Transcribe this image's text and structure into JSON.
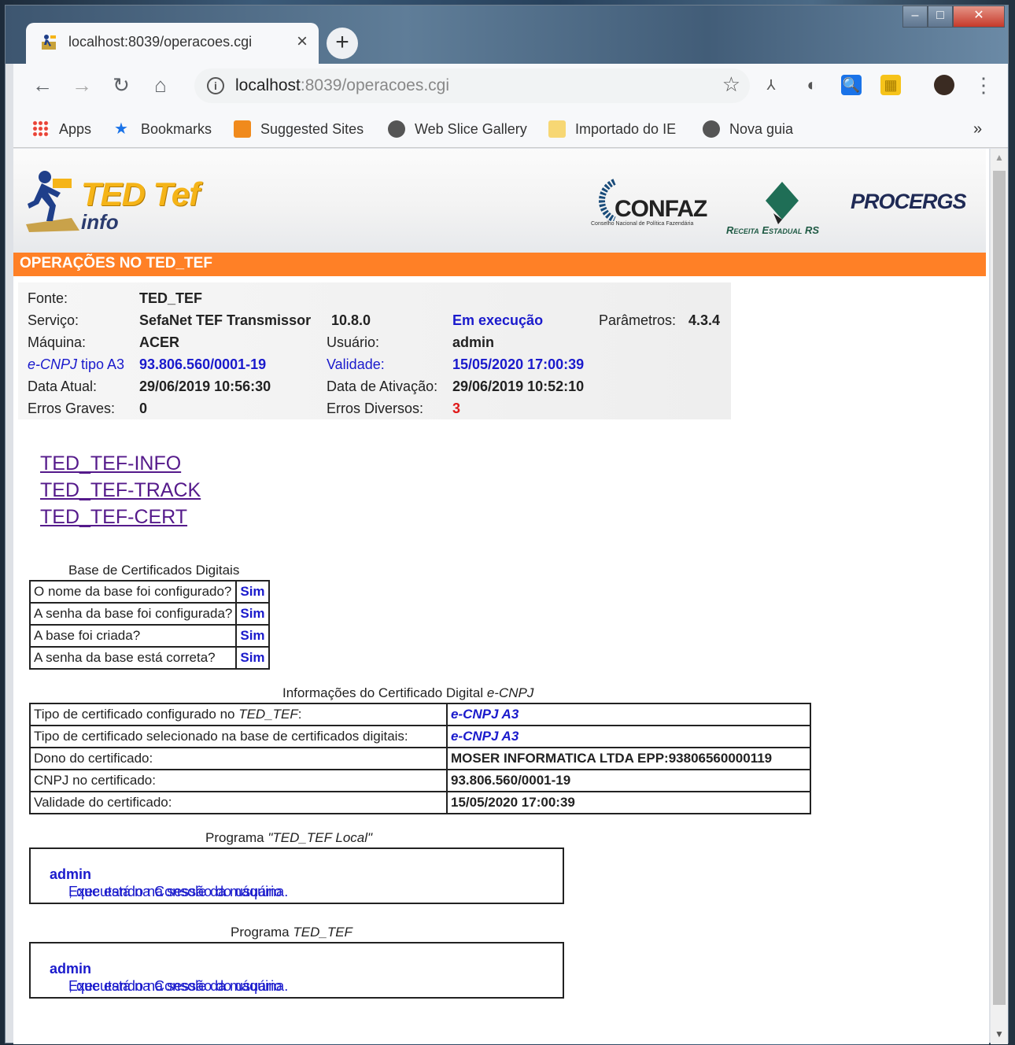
{
  "browser": {
    "tab_title": "localhost:8039/operacoes.cgi",
    "tab_close": "×",
    "new_tab": "+",
    "url_host": "localhost",
    "url_rest": ":8039/operacoes.cgi",
    "bookmarks": [
      "Apps",
      "Bookmarks",
      "Suggested Sites",
      "Web Slice Gallery",
      "Importado do IE",
      "Nova guia"
    ],
    "more": "»"
  },
  "header": {
    "logo_title": "TED Tef",
    "logo_sub": "info",
    "confaz": "CONFAZ",
    "confaz_sub": "Conselho Nacional de Política Fazendária",
    "receita": "Receita Estadual RS",
    "procergs": "PROCERGS",
    "section_title": "OPERAÇÕES NO TED_TEF"
  },
  "info": {
    "fonte_label": "Fonte:",
    "fonte": "TED_TEF",
    "servico_label": "Serviço:",
    "servico": "SefaNet TEF Transmissor",
    "versao": "10.8.0",
    "status": "Em execução",
    "parametros_label": "Parâmetros:",
    "parametros": "4.3.4",
    "maquina_label": "Máquina:",
    "maquina": "ACER",
    "usuario_label": "Usuário:",
    "usuario": "admin",
    "ecnpj_label_1": "e-CNPJ",
    "ecnpj_label_2": " tipo A3",
    "ecnpj": "93.806.560/0001-19",
    "validade_label": "Validade:",
    "validade": "15/05/2020 17:00:39",
    "data_atual_label": "Data Atual:",
    "data_atual": "29/06/2019 10:56:30",
    "data_ativacao_label": "Data de Ativação:",
    "data_ativacao": "29/06/2019 10:52:10",
    "erros_graves_label": "Erros Graves:",
    "erros_graves": "0",
    "erros_diversos_label": "Erros Diversos:",
    "erros_diversos": "3"
  },
  "links": [
    "TED_TEF-INFO",
    "TED_TEF-TRACK",
    "TED_TEF-CERT"
  ],
  "base_cert": {
    "caption": "Base de Certificados Digitais",
    "rows": [
      {
        "q": "O nome da base foi configurado?",
        "a": "Sim"
      },
      {
        "q": "A senha da base foi configurada?",
        "a": "Sim"
      },
      {
        "q": "A base foi criada?",
        "a": "Sim"
      },
      {
        "q": "A senha da base está correta?",
        "a": "Sim"
      }
    ]
  },
  "cert_info": {
    "caption": "Informações do Certificado Digital ",
    "caption_em": "e-CNPJ",
    "rows": [
      {
        "k": "Tipo de certificado configurado no ",
        "k_em": "TED_TEF",
        "k_end": ":",
        "v": "e-CNPJ A3"
      },
      {
        "k": "Tipo de certificado selecionado na base de certificados digitais:",
        "v": "e-CNPJ A3"
      },
      {
        "k": "Dono do certificado:",
        "v": "MOSER INFORMATICA LTDA EPP:93806560000119"
      },
      {
        "k": "CNPJ no certificado:",
        "v": "93.806.560/0001-19"
      },
      {
        "k": "Validade do certificado:",
        "v": "15/05/2020 17:00:39"
      }
    ]
  },
  "programa_local": {
    "caption": "Programa ",
    "caption_em": "\"TED_TEF Local\"",
    "msg_a": "Executando na sessão do usuário ",
    "msg_user": "admin",
    "msg_b": ", que está na Console da máquina."
  },
  "programa_tef": {
    "caption": "Programa ",
    "caption_em": "TED_TEF",
    "msg_a": "Executando na sessão do usuário ",
    "msg_user": "admin",
    "msg_b": ", que está na Console da máquina."
  }
}
